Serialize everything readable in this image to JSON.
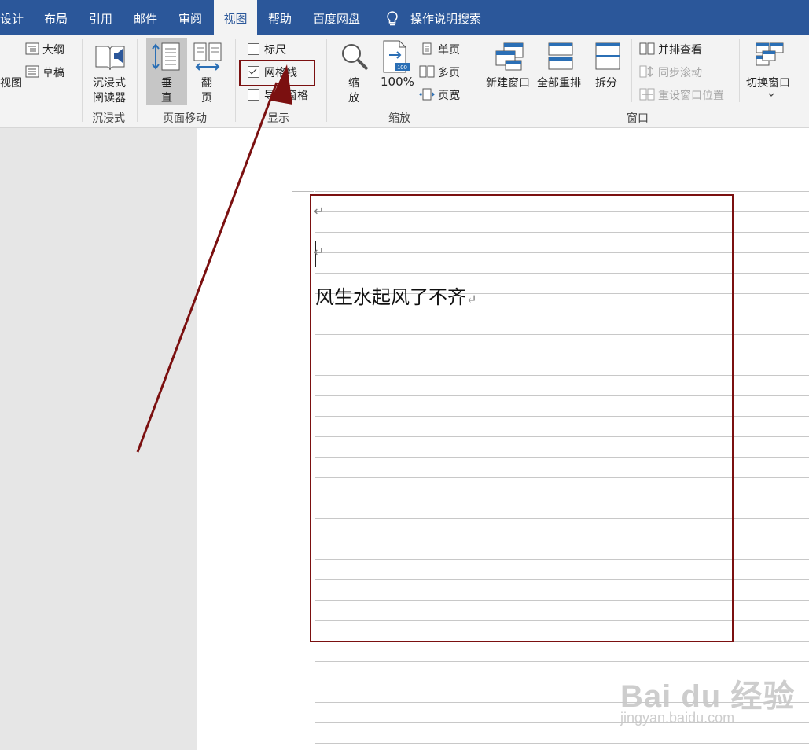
{
  "tabs": [
    {
      "label": "设计",
      "active": false
    },
    {
      "label": "布局",
      "active": false
    },
    {
      "label": "引用",
      "active": false
    },
    {
      "label": "邮件",
      "active": false
    },
    {
      "label": "审阅",
      "active": false
    },
    {
      "label": "视图",
      "active": true
    },
    {
      "label": "帮助",
      "active": false
    },
    {
      "label": "百度网盘",
      "active": false
    }
  ],
  "tell_me": "操作说明搜索",
  "ribbon": {
    "views": {
      "partial_label": "视图",
      "outline": "大纲",
      "draft": "草稿"
    },
    "immersive": {
      "reader_line1": "沉浸式",
      "reader_line2": "阅读器",
      "group": "沉浸式"
    },
    "page_movement": {
      "vertical_line1": "垂",
      "vertical_line2": "直",
      "side_line1": "翻",
      "side_line2": "页",
      "group": "页面移动"
    },
    "show": {
      "ruler": "标尺",
      "gridlines": "网格线",
      "nav_pane": "导航窗格",
      "group": "显示",
      "ruler_checked": false,
      "gridlines_checked": true,
      "nav_pane_checked": false
    },
    "zoom": {
      "zoom_line1": "缩",
      "zoom_line2": "放",
      "zoom_100": "100%",
      "zoom_badge": "100",
      "one_page": "单页",
      "multi_page": "多页",
      "page_width": "页宽",
      "group": "缩放"
    },
    "window": {
      "new_window": "新建窗口",
      "arrange_all": "全部重排",
      "split": "拆分",
      "side_by_side": "并排查看",
      "sync_scroll": "同步滚动",
      "reset_position": "重设窗口位置",
      "switch_windows": "切换窗口",
      "group": "窗口"
    }
  },
  "document": {
    "para_mark": "↵",
    "text": "风生水起风了不齐"
  },
  "watermark": {
    "brand": "Bai du 经验",
    "url": "jingyan.baidu.com"
  },
  "colors": {
    "ribbon_blue": "#2b579a",
    "highlight": "#7b1010",
    "arrow": "#7b1010"
  }
}
